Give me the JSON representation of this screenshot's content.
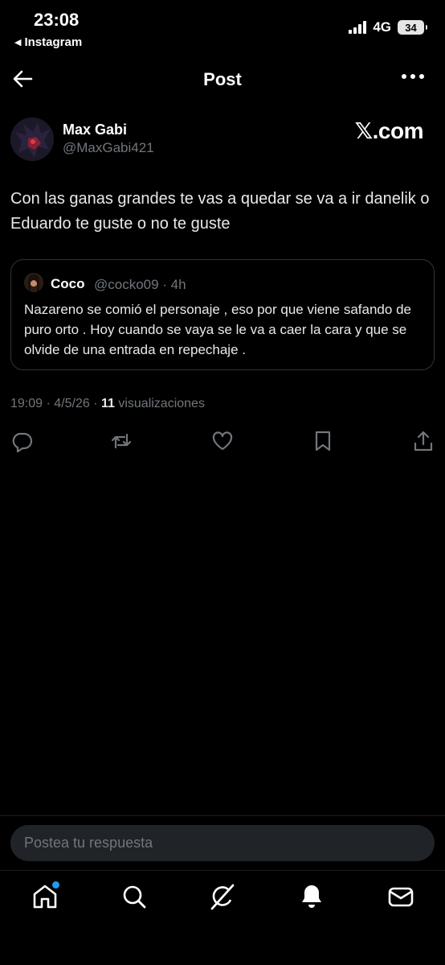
{
  "status_bar": {
    "time": "23:08",
    "back_app": "Instagram",
    "network": "4G",
    "battery": "34"
  },
  "header": {
    "title": "Post"
  },
  "post": {
    "author_name": "Max Gabi",
    "author_handle": "@MaxGabi421",
    "watermark": "𝕏.com",
    "text": "Con las ganas grandes te vas a quedar se va a ir danelik o Eduardo te guste o no te guste",
    "timestamp": "19:09 · 4/5/26 · ",
    "views_count": "11",
    "views_label": " visualizaciones"
  },
  "quote": {
    "author_name": "Coco",
    "author_handle": "@cocko09 · 4h",
    "text": "Nazareno se comió el personaje , eso por que viene safando de puro orto . Hoy cuando se vaya se le va a caer la cara y que se olvide de una entrada en repechaje ."
  },
  "actions": [
    "reply-icon",
    "retweet-icon",
    "like-icon",
    "bookmark-icon",
    "share-icon"
  ],
  "reply_box": {
    "placeholder": "Postea tu respuesta"
  },
  "bottom_nav": [
    "home-icon",
    "search-icon",
    "grok-icon",
    "notifications-icon",
    "messages-icon"
  ],
  "colors": {
    "background": "#000000",
    "text": "#e7e9ea",
    "muted": "#71767b",
    "border": "#2f3336",
    "accent": "#1d9bf0"
  }
}
